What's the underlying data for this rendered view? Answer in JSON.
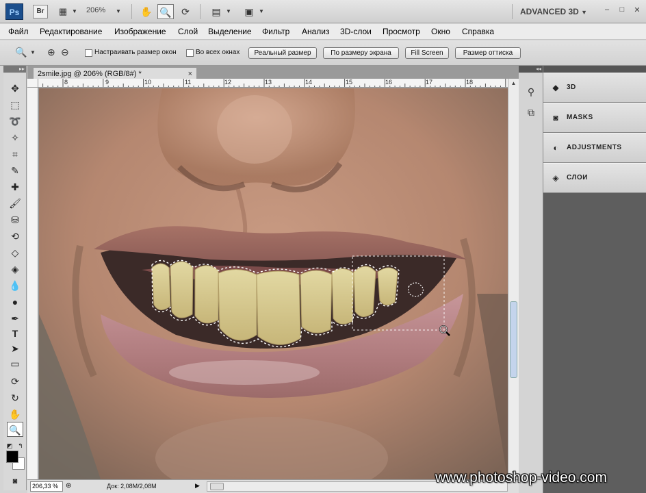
{
  "app_bar": {
    "ps_logo": "Ps",
    "br_logo": "Br",
    "zoom": "206%",
    "workspace": "ADVANCED 3D",
    "workspace_caret": "▼",
    "minimize": "–",
    "maximize": "□",
    "close": "✕"
  },
  "menu": {
    "items": [
      "Файл",
      "Редактирование",
      "Изображение",
      "Слой",
      "Выделение",
      "Фильтр",
      "Анализ",
      "3D-слои",
      "Просмотр",
      "Окно",
      "Справка"
    ]
  },
  "options": {
    "resize_windows_label": "Настраивать размер окон",
    "all_windows_label": "Во всех окнах",
    "actual_pixels": "Реальный размер",
    "fit_screen": "По размеру экрана",
    "fill_screen": "Fill Screen",
    "print_size": "Размер оттиска"
  },
  "document": {
    "tab_title": "2smile.jpg @ 206% (RGB/8#) *",
    "tab_close": "×",
    "ruler_marks": [
      "8",
      "9",
      "10",
      "11",
      "12",
      "13",
      "14",
      "15",
      "16",
      "17",
      "18"
    ]
  },
  "status": {
    "zoom_value": "206,33 %",
    "doc_size": "Док: 2,08M/2,08M",
    "arrow": "▶"
  },
  "panels": {
    "collapse": "◂◂",
    "items": [
      {
        "label": "3D",
        "icon": "cube-icon"
      },
      {
        "label": "MASKS",
        "icon": "mask-icon"
      },
      {
        "label": "ADJUSTMENTS",
        "icon": "adjustments-icon"
      },
      {
        "label": "СЛОИ",
        "icon": "layers-icon"
      }
    ]
  },
  "watermark": "www.photoshop-video.com",
  "colors": {
    "foreground": "#000000",
    "background": "#ffffff",
    "selection_marquee": "#ffffff"
  }
}
